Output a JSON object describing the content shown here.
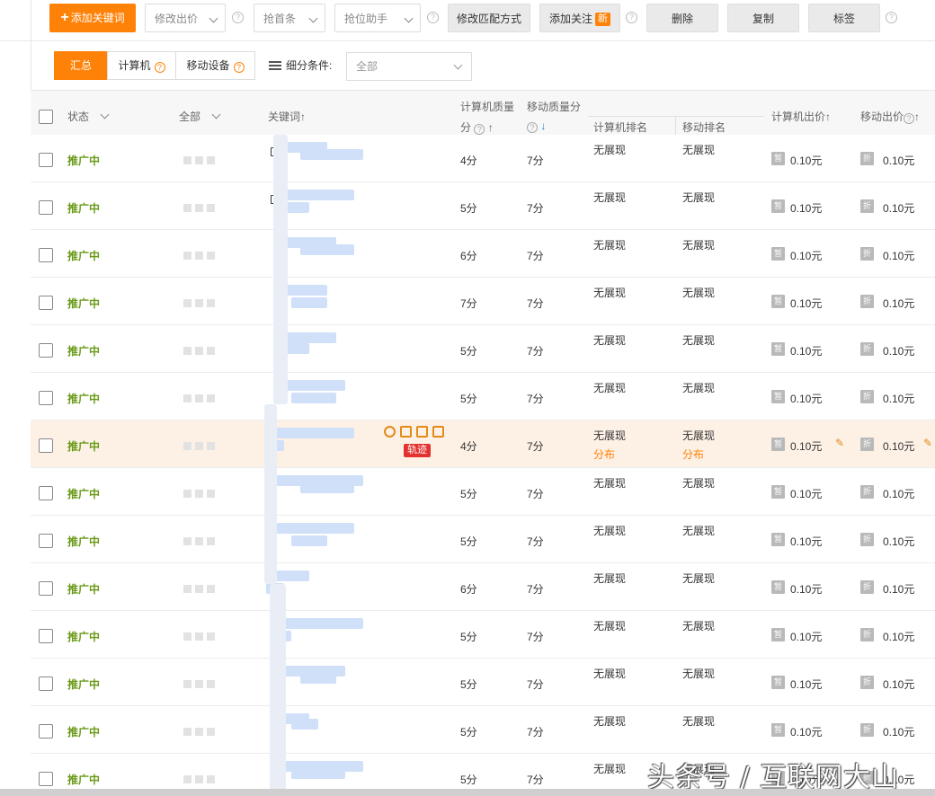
{
  "toolbar": {
    "add_keyword": "添加关键词",
    "modify_bid": "修改出价",
    "grab_top": "抢首条",
    "grab_helper": "抢位助手",
    "modify_match": "修改匹配方式",
    "add_follow": "添加关注",
    "new_badge": "新",
    "delete": "删除",
    "copy": "复制",
    "tag": "标签",
    "help_glyph": "?"
  },
  "filters": {
    "tabs": [
      {
        "label": "汇总",
        "active": true
      },
      {
        "label": "计算机",
        "active": false
      },
      {
        "label": "移动设备",
        "active": false
      }
    ],
    "condition_label": "细分条件:",
    "condition_value": "全部"
  },
  "table": {
    "headers": {
      "status": "状态",
      "all": "全部",
      "keyword": "关键词↑",
      "pc_quality_l1": "计算机质量",
      "pc_quality_l2": "分",
      "pc_quality_arrow": "↑",
      "mobile_quality": "移动质量分",
      "mobile_quality_arrow": "↓",
      "pc_rank": "计算机排名",
      "mobile_rank": "移动排名",
      "pc_bid": "计算机出价↑",
      "mobile_bid": "移动出价",
      "mobile_bid_arrow": "↑"
    },
    "rows": [
      {
        "status": "推广中",
        "pc_quality": "4分",
        "mobile_quality": "7分",
        "pc_rank": "无展现",
        "mobile_rank": "无展现",
        "pc_bid": "0.10元",
        "mobile_bid": "0.10元"
      },
      {
        "status": "推广中",
        "pc_quality": "5分",
        "mobile_quality": "7分",
        "pc_rank": "无展现",
        "mobile_rank": "无展现",
        "pc_bid": "0.10元",
        "mobile_bid": "0.10元"
      },
      {
        "status": "推广中",
        "pc_quality": "6分",
        "mobile_quality": "7分",
        "pc_rank": "无展现",
        "mobile_rank": "无展现",
        "pc_bid": "0.10元",
        "mobile_bid": "0.10元"
      },
      {
        "status": "推广中",
        "pc_quality": "7分",
        "mobile_quality": "7分",
        "pc_rank": "无展现",
        "mobile_rank": "无展现",
        "pc_bid": "0.10元",
        "mobile_bid": "0.10元"
      },
      {
        "status": "推广中",
        "pc_quality": "5分",
        "mobile_quality": "7分",
        "pc_rank": "无展现",
        "mobile_rank": "无展现",
        "pc_bid": "0.10元",
        "mobile_bid": "0.10元"
      },
      {
        "status": "推广中",
        "pc_quality": "5分",
        "mobile_quality": "7分",
        "pc_rank": "无展现",
        "mobile_rank": "无展现",
        "pc_bid": "0.10元",
        "mobile_bid": "0.10元"
      },
      {
        "status": "推广中",
        "pc_quality": "4分",
        "mobile_quality": "7分",
        "pc_rank": "无展现",
        "mobile_rank": "无展现",
        "pc_bid": "0.10元",
        "mobile_bid": "0.10元",
        "highlight": true,
        "pc_rank_sub": "分布",
        "mobile_rank_sub": "分布",
        "trail": "轨迹"
      },
      {
        "status": "推广中",
        "pc_quality": "5分",
        "mobile_quality": "7分",
        "pc_rank": "无展现",
        "mobile_rank": "无展现",
        "pc_bid": "0.10元",
        "mobile_bid": "0.10元"
      },
      {
        "status": "推广中",
        "pc_quality": "5分",
        "mobile_quality": "7分",
        "pc_rank": "无展现",
        "mobile_rank": "无展现",
        "pc_bid": "0.10元",
        "mobile_bid": "0.10元"
      },
      {
        "status": "推广中",
        "pc_quality": "6分",
        "mobile_quality": "7分",
        "pc_rank": "无展现",
        "mobile_rank": "无展现",
        "pc_bid": "0.10元",
        "mobile_bid": "0.10元"
      },
      {
        "status": "推广中",
        "pc_quality": "5分",
        "mobile_quality": "7分",
        "pc_rank": "无展现",
        "mobile_rank": "无展现",
        "pc_bid": "0.10元",
        "mobile_bid": "0.10元"
      },
      {
        "status": "推广中",
        "pc_quality": "5分",
        "mobile_quality": "7分",
        "pc_rank": "无展现",
        "mobile_rank": "无展现",
        "pc_bid": "0.10元",
        "mobile_bid": "0.10元"
      },
      {
        "status": "推广中",
        "pc_quality": "5分",
        "mobile_quality": "7分",
        "pc_rank": "无展现",
        "mobile_rank": "无展现",
        "pc_bid": "0.10元",
        "mobile_bid": "0.10元"
      },
      {
        "status": "推广中",
        "pc_quality": "5分",
        "mobile_quality": "7分",
        "pc_rank": "无展现",
        "mobile_rank": "无展现",
        "pc_bid": "0.10元",
        "mobile_bid": "0.10元"
      }
    ],
    "pc_bid_icon": "暂",
    "mobile_bid_icon": "折"
  },
  "watermark": "头条号 / 互联网大山",
  "colors": {
    "accent": "#ff8208",
    "status_green": "#6a9a17",
    "trail_red": "#e2312f"
  }
}
